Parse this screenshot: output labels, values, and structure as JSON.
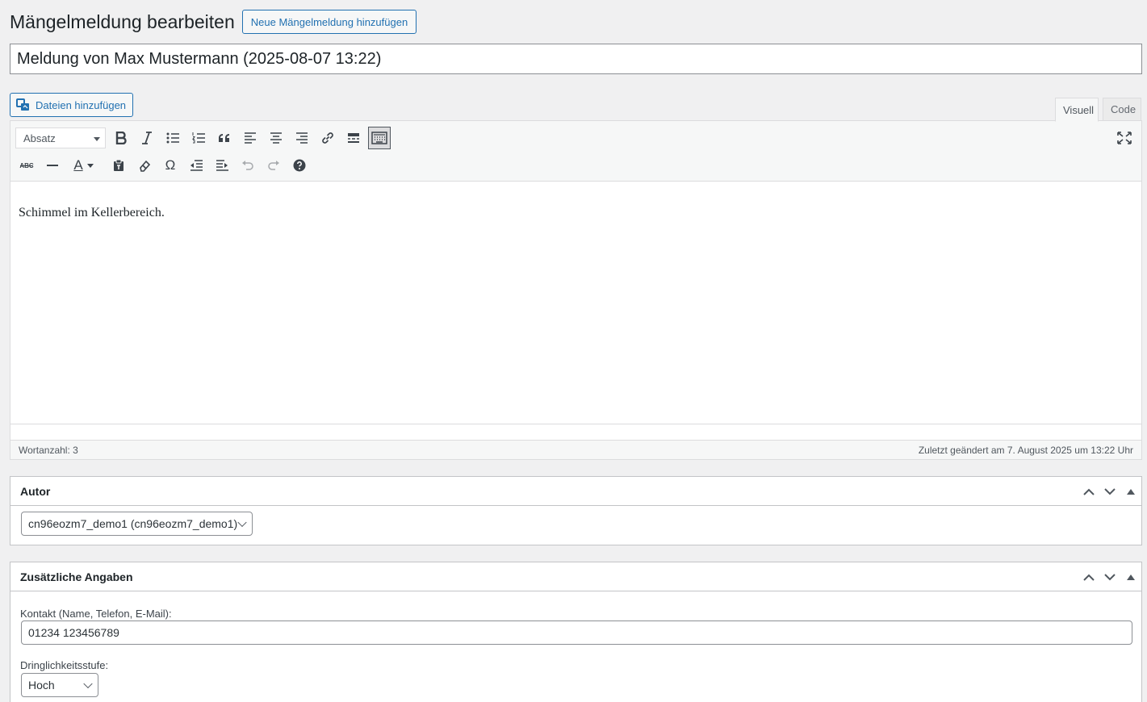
{
  "header": {
    "page_title": "Mängelmeldung bearbeiten",
    "add_new_label": "Neue Mängelmeldung hinzufügen"
  },
  "post": {
    "title": "Meldung von Max Mustermann (2025-08-07 13:22)"
  },
  "editor": {
    "media_button_label": "Dateien hinzufügen",
    "tabs": [
      {
        "label": "Visuell",
        "active": true
      },
      {
        "label": "Code",
        "active": false
      }
    ],
    "format_select": "Absatz",
    "toolbar_row1": [
      "bold-icon",
      "italic-icon",
      "bulleted-list-icon",
      "numbered-list-icon",
      "blockquote-icon",
      "align-left-icon",
      "align-center-icon",
      "align-right-icon",
      "link-icon",
      "read-more-icon",
      "toolbar-toggle-icon",
      "fullscreen-icon"
    ],
    "toolbar_row2": [
      "strikethrough-icon",
      "horizontal-line-icon",
      "text-color-icon",
      "paste-text-icon",
      "clear-formatting-icon",
      "special-character-icon",
      "outdent-icon",
      "indent-icon",
      "undo-icon",
      "redo-icon",
      "help-icon"
    ],
    "strikethrough_glyph": "ABC",
    "text_color_glyph": "A",
    "content": "Schimmel im Kellerbereich.",
    "word_count": "Wortanzahl: 3",
    "last_modified": "Zuletzt geändert am 7. August 2025 um 13:22 Uhr"
  },
  "author_box": {
    "title": "Autor",
    "selected_author": "cn96eozm7_demo1 (cn96eozm7_demo1)"
  },
  "extra_box": {
    "title": "Zusätzliche Angaben",
    "contact_label": "Kontakt (Name, Telefon, E-Mail):",
    "contact_value": "01234 123456789",
    "urgency_label": "Dringlichkeitsstufe:",
    "urgency_value": "Hoch"
  },
  "colors": {
    "accent": "#2271b1",
    "background": "#f0f0f1",
    "border": "#c3c4c7"
  }
}
